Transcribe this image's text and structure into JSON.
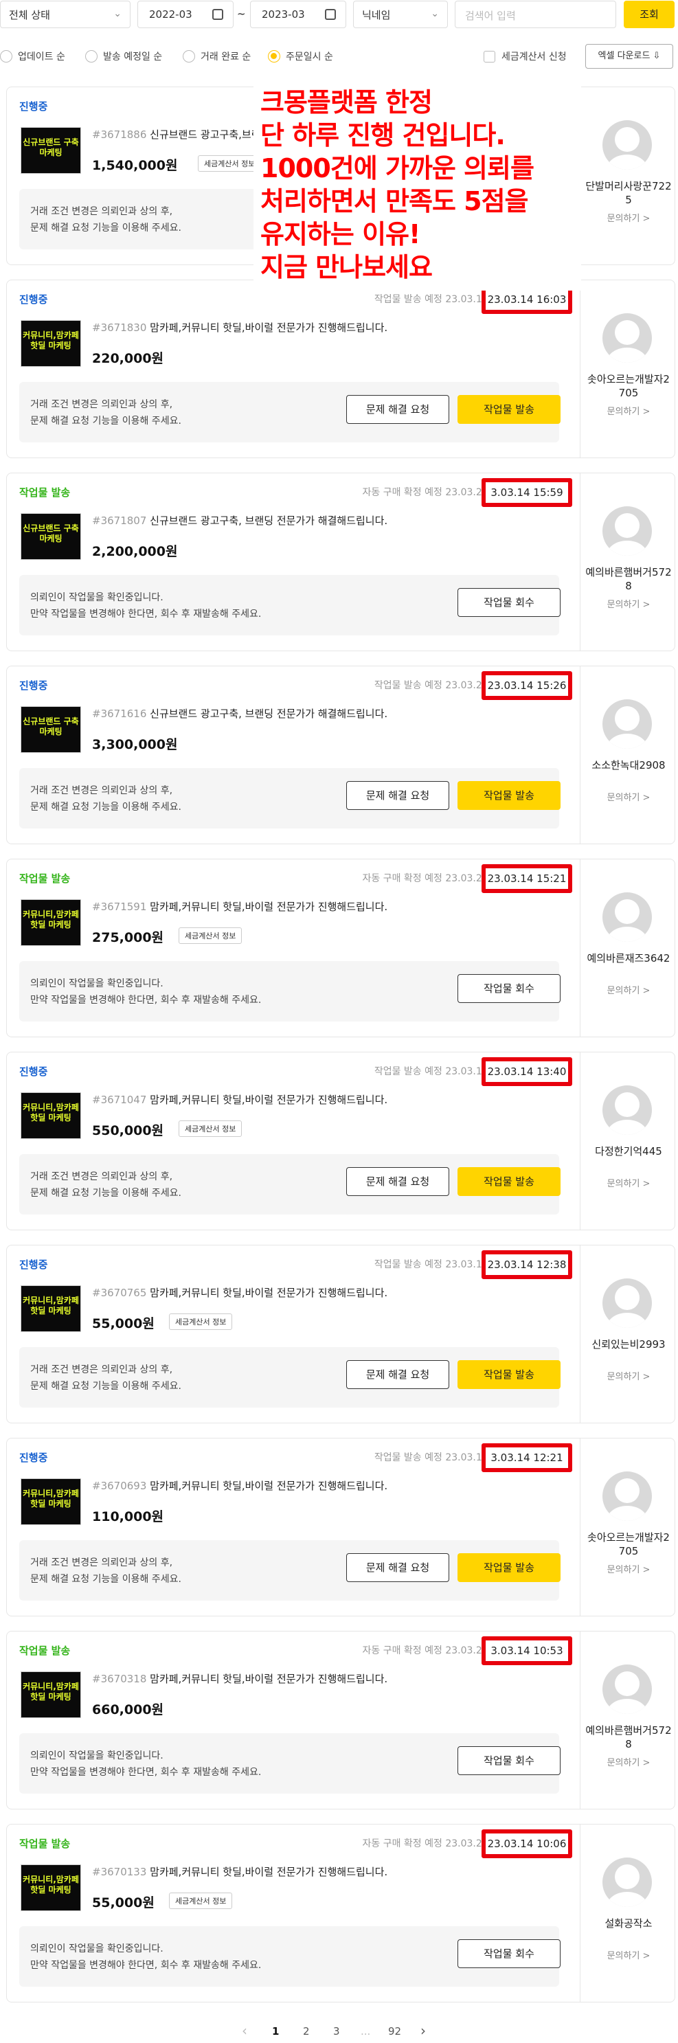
{
  "filters": {
    "status_select": "전체 상태",
    "date_from": "2022-03",
    "date_tilde": "~",
    "date_to": "2023-03",
    "nickname_select": "닉네임",
    "search_placeholder": "검색어 입력",
    "search_button": "조회"
  },
  "sort": {
    "options": [
      "업데이트 순",
      "발송 예정일 순",
      "거래 완료 순",
      "주문일시 순"
    ],
    "selected_index": 3,
    "tax_invoice_checkbox": "세금계산서 신청",
    "excel_button": "엑셀 다운로드 ⇩"
  },
  "ad_overlay": [
    "크몽플랫폼 한정",
    "단 하루 진행 건입니다.",
    "1000건에 가까운 의뢰를",
    "처리하면서 만족도 5점을",
    "유지하는 이유!",
    "지금 만나보세요"
  ],
  "labels": {
    "order_date": "주문일시",
    "inquiry": "문의하기 >",
    "issue_button": "문제 해결 요청",
    "send_button": "작업물 발송",
    "retrieve_button": "작업물 회수",
    "tax_info": "세금계산서 정보",
    "notice_progress_1": "거래 조건 변경은 의뢰인과 상의 후,",
    "notice_progress_2": "문제 해결 요청 기능을 이용해 주세요.",
    "notice_sent_1": "의뢰인이 작업물을 확인중입니다.",
    "notice_sent_2": "만약 작업물을 변경해야 한다면, 회수 후 재발송해 주세요."
  },
  "orders": [
    {
      "status": "진행중",
      "due": "",
      "order_time": "",
      "order_no": "#3671886",
      "title": "신규브랜드 광고구축,브랜딩 전문가가 해결해드립니다.",
      "price": "1,540,000원",
      "tax": true,
      "user": "단발머리사랑꾼7225",
      "thumb": "신규브랜드 구축 마케팅"
    },
    {
      "status": "진행중",
      "due": "작업물 발송 예정 23.03.16 16:36",
      "order_time": "23.03.14 16:03",
      "order_no": "#3671830",
      "title": "맘카페,커뮤니티 핫딜,바이럴 전문가가 진행해드립니다.",
      "price": "220,000원",
      "tax": false,
      "user": "솟아오르는개발자2705",
      "thumb": "커뮤니티,맘카페 핫딜 마케팅"
    },
    {
      "status": "작업물 발송",
      "due": "자동 구매 확정 예정 23.03.21 17:01",
      "order_time": "3.03.14 15:59",
      "order_no": "#3671807",
      "title": "신규브랜드 광고구축, 브랜딩 전문가가 해결해드립니다.",
      "price": "2,200,000원",
      "tax": false,
      "user": "예의바른햄버거5728",
      "thumb": "신규브랜드 구축 마케팅"
    },
    {
      "status": "진행중",
      "due": "작업물 발송 예정 23.03.28 15:26",
      "order_time": "23.03.14 15:26",
      "order_no": "#3671616",
      "title": "신규브랜드 광고구축, 브랜딩 전문가가 해결해드립니다.",
      "price": "3,300,000원",
      "tax": false,
      "user": "소소한녹대2908",
      "thumb": "신규브랜드 구축 마케팅"
    },
    {
      "status": "작업물 발송",
      "due": "자동 구매 확정 예정 23.03.21 15:27",
      "order_time": "23.03.14 15:21",
      "order_no": "#3671591",
      "title": "맘카페,커뮤니티 핫딜,바이럴 전문가가 진행해드립니다.",
      "price": "275,000원",
      "tax": true,
      "user": "예의바른재즈3642",
      "thumb": "커뮤니티,맘카페 핫딜 마케팅"
    },
    {
      "status": "진행중",
      "due": "작업물 발송 예정 23.03.17 16:36",
      "order_time": "23.03.14 13:40",
      "order_no": "#3671047",
      "title": "맘카페,커뮤니티 핫딜,바이럴 전문가가 진행해드립니다.",
      "price": "550,000원",
      "tax": true,
      "user": "다정한기억445",
      "thumb": "커뮤니티,맘카페 핫딜 마케팅"
    },
    {
      "status": "진행중",
      "due": "작업물 발송 예정 23.03.18 16:36",
      "order_time": "23.03.14 12:38",
      "order_no": "#3670765",
      "title": "맘카페,커뮤니티 핫딜,바이럴 전문가가 진행해드립니다.",
      "price": "55,000원",
      "tax": true,
      "user": "신뢰있는비2993",
      "thumb": "커뮤니티,맘카페 핫딜 마케팅"
    },
    {
      "status": "진행중",
      "due": "작업물 발송 예정 23.03.16 16:36",
      "order_time": "3.03.14 12:21",
      "order_no": "#3670693",
      "title": "맘카페,커뮤니티 핫딜,바이럴 전문가가 진행해드립니다.",
      "price": "110,000원",
      "tax": false,
      "user": "솟아오르는개발자2705",
      "thumb": "커뮤니티,맘카페 핫딜 마케팅"
    },
    {
      "status": "작업물 발송",
      "due": "자동 구매 확정 예정 23.03.21 13:46",
      "order_time": "3.03.14 10:53",
      "order_no": "#3670318",
      "title": "맘카페,커뮤니티 핫딜,바이럴 전문가가 진행해드립니다.",
      "price": "660,000원",
      "tax": false,
      "user": "예의바른햄버거5728",
      "thumb": "커뮤니티,맘카페 핫딜 마케팅"
    },
    {
      "status": "작업물 발송",
      "due": "자동 구매 확정 예정 23.03.21 11:17",
      "order_time": "23.03.14 10:06",
      "order_no": "#3670133",
      "title": "맘카페,커뮤니티 핫딜,바이럴 전문가가 진행해드립니다.",
      "price": "55,000원",
      "tax": true,
      "user": "설화공작소",
      "thumb": "커뮤니티,맘카페 핫딜 마케팅"
    }
  ],
  "pagination": {
    "prev": "‹",
    "pages": [
      "1",
      "2",
      "3",
      "...",
      "92"
    ],
    "next": "›",
    "current": "1"
  }
}
